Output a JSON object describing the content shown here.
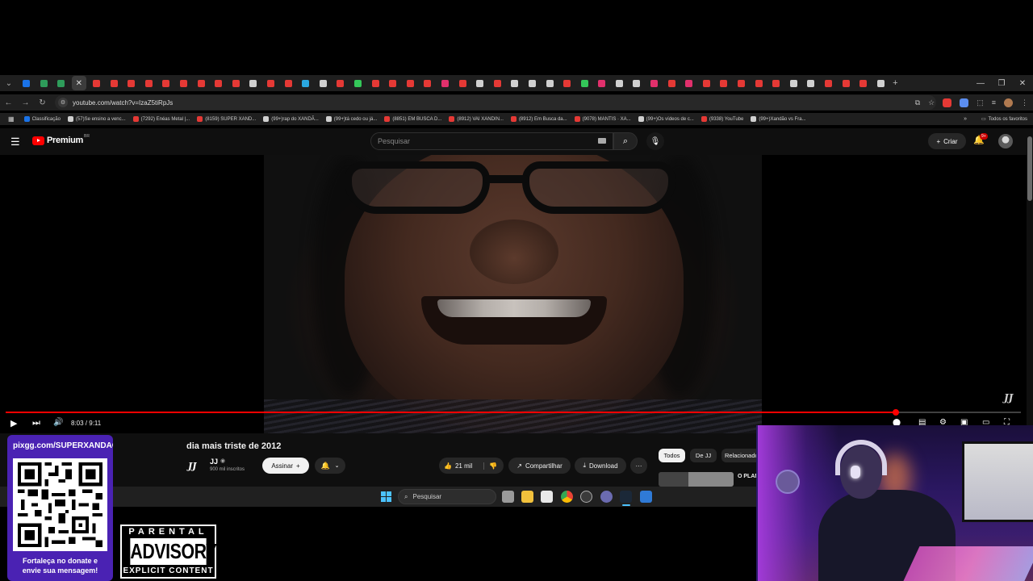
{
  "browser": {
    "url": "youtube.com/watch?v=IzaZ5tiRpJs",
    "tab_colors": [
      "#1a73e8",
      "#2e9c5a",
      "#2e9c5a",
      "#e53935",
      "#e53935",
      "#e53935",
      "#e53935",
      "#e53935",
      "#e53935",
      "#e53935",
      "#e53935",
      "#e53935",
      "#e53935",
      "#d0d0d0",
      "#e53935",
      "#e53935",
      "#2aa7e0",
      "#d0d0d0",
      "#e53935",
      "#34c759",
      "#e53935",
      "#e53935",
      "#e53935",
      "#e53935",
      "#e1306c",
      "#e53935",
      "#d0d0d0",
      "#e53935",
      "#d0d0d0",
      "#d0d0d0",
      "#d0d0d0",
      "#e53935",
      "#34c759",
      "#e1306c",
      "#d0d0d0",
      "#d0d0d0",
      "#e1306c",
      "#e53935",
      "#e1306c",
      "#e53935",
      "#e53935",
      "#e53935",
      "#e53935",
      "#e53935",
      "#d0d0d0",
      "#d0d0d0",
      "#e53935",
      "#e53935",
      "#e53935",
      "#d0d0d0"
    ],
    "bookmarks": [
      {
        "label": "Classificação",
        "color": "#1a73e8"
      },
      {
        "label": "(57)Se ensino a venc...",
        "color": "#d0d0d0"
      },
      {
        "label": "(7292) Enéas Metal |...",
        "color": "#e53935"
      },
      {
        "label": "(8159) SUPER XAND...",
        "color": "#e53935"
      },
      {
        "label": "(99+)rap do XANDÃ...",
        "color": "#d0d0d0"
      },
      {
        "label": "(99+)tá cedo ou já...",
        "color": "#d0d0d0"
      },
      {
        "label": "(8851) EM BUSCA D...",
        "color": "#e53935"
      },
      {
        "label": "(8912) VAI XANDIN...",
        "color": "#e53935"
      },
      {
        "label": "(8912) Em Busca da...",
        "color": "#e53935"
      },
      {
        "label": "(9078) MANTIS · XA...",
        "color": "#e53935"
      },
      {
        "label": "(99+)Os vídeos de c...",
        "color": "#d0d0d0"
      },
      {
        "label": "(9338) YouTube",
        "color": "#e53935"
      },
      {
        "label": "(99+)Xandão vs Fra...",
        "color": "#d0d0d0"
      }
    ],
    "all_bookmarks_label": "Todos os favoritos"
  },
  "youtube": {
    "brand": "Premium",
    "brand_sup": "BR",
    "search_placeholder": "Pesquisar",
    "create_label": "Criar",
    "notification_badge": "9+"
  },
  "player": {
    "time_current": "8:03",
    "time_total": "9:11",
    "time_display": "8:03 / 9:11",
    "progress_fraction": 0.877,
    "watermark": "JJ"
  },
  "video": {
    "title": "dia mais triste de 2012",
    "channel_name": "JJ",
    "channel_logo": "JJ",
    "subscribers": "900 mil inscritos",
    "subscribe_label": "Assinar",
    "likes": "21 mil",
    "share_label": "Compartilhar",
    "download_label": "Download"
  },
  "sidebar": {
    "chips": [
      "Todos",
      "De JJ",
      "Relacionados"
    ],
    "rec_title": "O PLANO BRA"
  },
  "taskbar": {
    "search_placeholder": "Pesquisar"
  },
  "overlay": {
    "donate_url": "pixgg.com/SUPERXANDAO",
    "donate_message_1": "Fortaleça no donate e",
    "donate_message_2": "envie sua mensagem!",
    "advisory_top": "PARENTAL",
    "advisory_mid": "ADVISORY",
    "advisory_bottom": "EXPLICIT CONTENT"
  },
  "colors": {
    "accent_red": "#ff0000",
    "overlay_purple": "#4a22b3",
    "taskbar_accent": "#4cc2ff"
  }
}
